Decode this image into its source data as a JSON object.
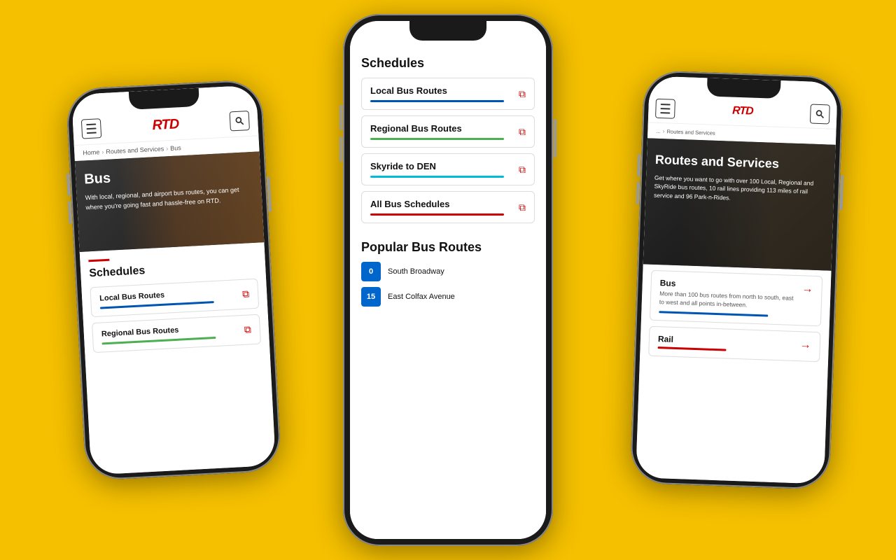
{
  "background": "#F5C000",
  "phones": {
    "left": {
      "header": {
        "logo": "RTD",
        "menu_label": "menu",
        "search_label": "search"
      },
      "breadcrumb": {
        "items": [
          "Home",
          "Routes and Services",
          "Bus"
        ]
      },
      "hero": {
        "title": "Bus",
        "description": "With local, regional, and airport bus routes, you can get where you're going fast and hassle-free on RTD."
      },
      "schedules": {
        "title": "Schedules",
        "routes": [
          {
            "label": "Local Bus Routes",
            "color": "#0055b3"
          },
          {
            "label": "Regional Bus Routes",
            "color": "#4caf50"
          }
        ]
      }
    },
    "center": {
      "schedules": {
        "title": "Schedules",
        "routes": [
          {
            "label": "Local Bus Routes",
            "color": "#0055b3"
          },
          {
            "label": "Regional Bus Routes",
            "color": "#4caf50"
          },
          {
            "label": "Skyride to DEN",
            "color": "#00bcd4"
          },
          {
            "label": "All Bus Schedules",
            "color": "#cc0000"
          }
        ]
      },
      "popular": {
        "title": "Popular Bus Routes",
        "items": [
          {
            "badge": "0",
            "label": "South Broadway",
            "color": "blue"
          },
          {
            "badge": "15",
            "label": "East Colfax Avenue",
            "color": "blue"
          }
        ]
      }
    },
    "right": {
      "header": {
        "logo": "RTD",
        "menu_label": "menu",
        "search_label": "search"
      },
      "breadcrumb": {
        "items": [
          "...",
          "Routes and Services"
        ]
      },
      "hero": {
        "title": "Routes and Services",
        "description": "Get where you want to go with over 100 Local, Regional and SkyRide bus routes, 10 rail lines providing 113 miles of rail service and 96 Park-n-Rides."
      },
      "services": [
        {
          "title": "Bus",
          "description": "More than 100 bus routes from north to south, east to west and all points in-between.",
          "color": "#0055b3"
        },
        {
          "title": "Rail",
          "description": "",
          "color": "#cc0000"
        }
      ]
    }
  }
}
